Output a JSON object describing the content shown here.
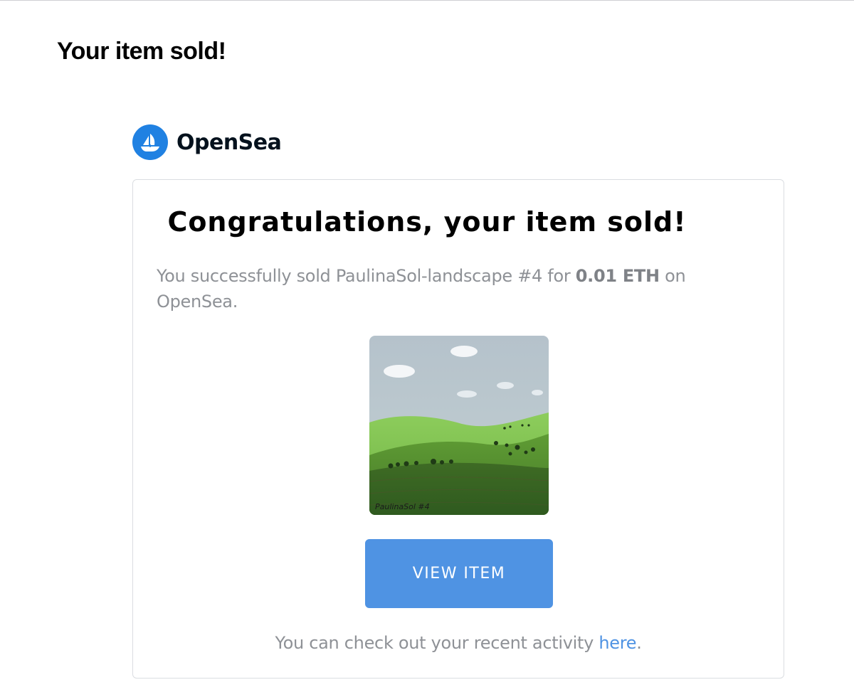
{
  "email": {
    "subject": "Your item sold!"
  },
  "brand": {
    "name": "OpenSea",
    "logo_icon": "opensea-boat-icon",
    "logo_color": "#2081e2"
  },
  "card": {
    "title": "Congratulations, your item sold!",
    "message_prefix": "You successfully sold PaulinaSol-landscape #4 for",
    "price": "0.01 ETH",
    "message_suffix": "on OpenSea.",
    "item_image": {
      "signature": "PaulinaSol #4"
    },
    "view_button_label": "VIEW ITEM",
    "view_button_color": "#4f93e3",
    "footer_prefix": "You can check out your recent activity",
    "footer_link_label": "here",
    "footer_suffix": "."
  }
}
